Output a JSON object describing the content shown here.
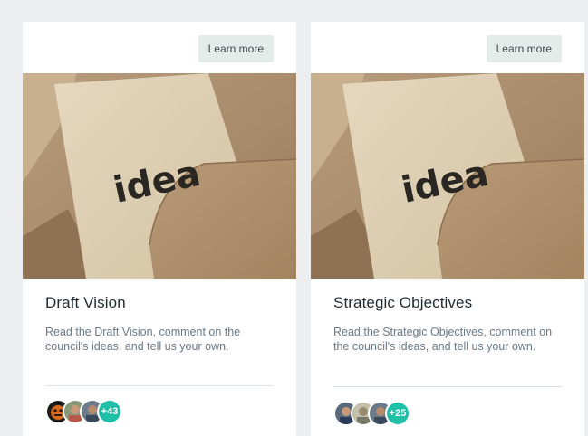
{
  "cards": [
    {
      "learn_more_label": "Learn more",
      "image_word": "idea",
      "title": "Draft Vision",
      "description": "Read the Draft Vision, comment on the council's ideas, and tell us your own.",
      "participant_count": "+43"
    },
    {
      "learn_more_label": "Learn more",
      "image_word": "idea",
      "title": "Strategic Objectives",
      "description": "Read the Strategic Objectives, comment on the council's ideas, and tell us your own.",
      "participant_count": "+25"
    }
  ],
  "colors": {
    "page_background": "#eceef0",
    "card_background": "#ffffff",
    "button_background": "#e4ecea",
    "count_badge": "#1fbfa8",
    "description_text": "#6a7a88"
  }
}
